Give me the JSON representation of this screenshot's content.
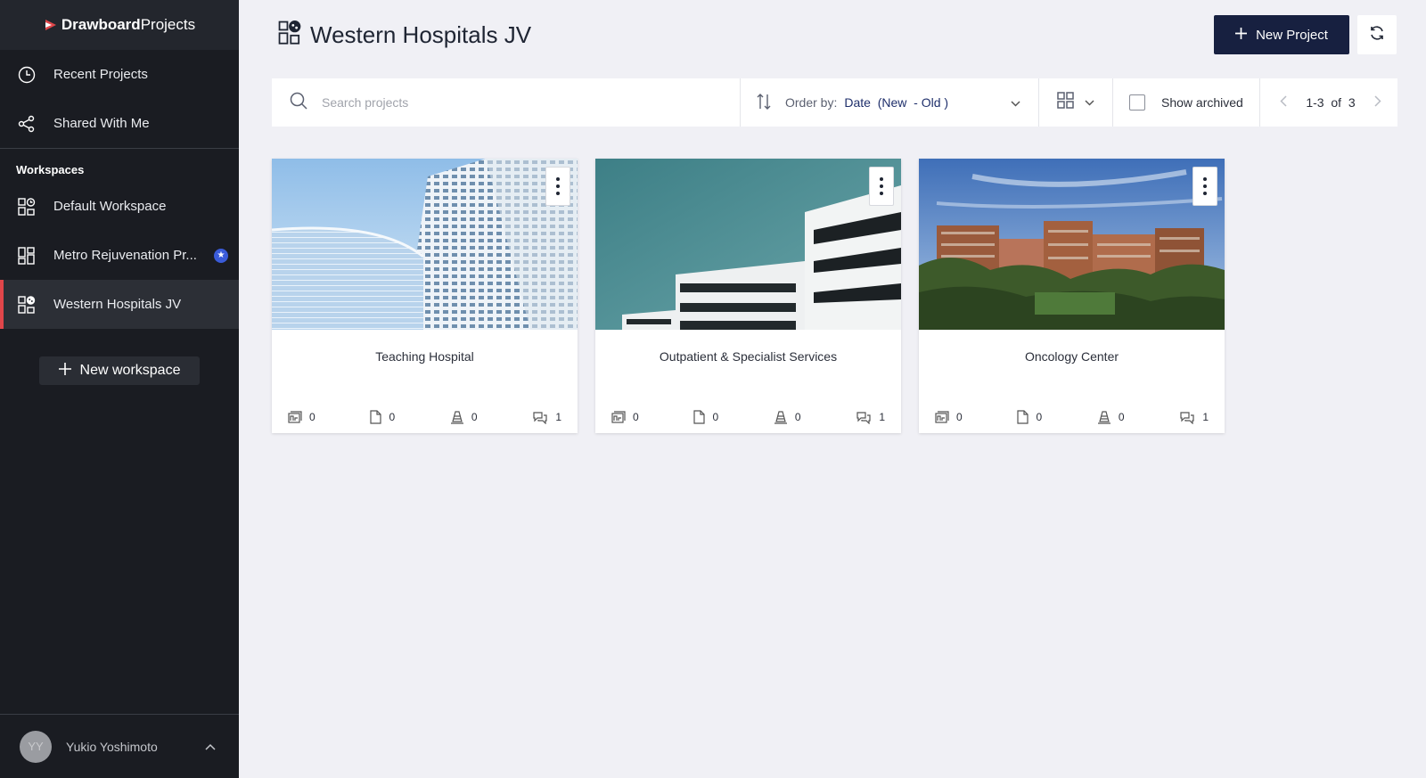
{
  "brand": {
    "part1": "Drawboard",
    "part2": "Projects"
  },
  "sidebar": {
    "nav": [
      {
        "label": "Recent Projects",
        "icon": "clock-icon"
      },
      {
        "label": "Shared With Me",
        "icon": "share-icon"
      }
    ],
    "workspaces_heading": "Workspaces",
    "workspaces": [
      {
        "label": "Default Workspace",
        "icon": "workspace-icon"
      },
      {
        "label": "Metro Rejuvenation Pr...",
        "icon": "workspace-grid-icon",
        "starred": true
      },
      {
        "label": "Western Hospitals JV",
        "icon": "workspace-icon",
        "active": true
      }
    ],
    "new_workspace_label": "New workspace",
    "user": {
      "initials": "YY",
      "name": "Yukio Yoshimoto"
    }
  },
  "header": {
    "title": "Western Hospitals JV",
    "new_project_label": "New Project"
  },
  "toolbar": {
    "search_placeholder": "Search projects",
    "order_label": "Order by:",
    "order_value": "Date  (New  - Old )",
    "show_archived_label": "Show archived",
    "pager": "1-3  of  3"
  },
  "projects": [
    {
      "title": "Teaching Hospital",
      "stats": [
        "0",
        "0",
        "0",
        "1"
      ]
    },
    {
      "title": "Outpatient & Specialist Services",
      "stats": [
        "0",
        "0",
        "0",
        "1"
      ]
    },
    {
      "title": "Oncology Center",
      "stats": [
        "0",
        "0",
        "0",
        "1"
      ]
    }
  ],
  "colors": {
    "primary": "#172040",
    "accent": "#e0464a",
    "sidebar": "#1a1c22",
    "star": "#3a5bd9"
  }
}
